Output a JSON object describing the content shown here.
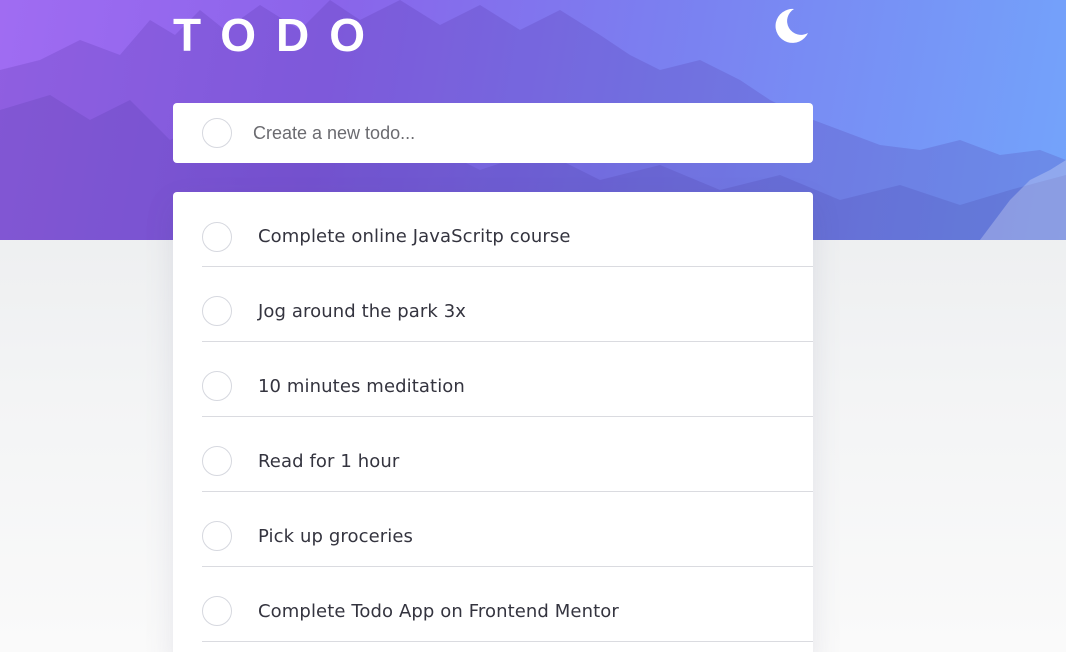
{
  "header": {
    "title": "TODO",
    "theme_icon": "moon-icon"
  },
  "new_todo": {
    "placeholder": "Create a new todo...",
    "value": ""
  },
  "todos": [
    {
      "label": "Complete online JavaScritp course",
      "completed": false
    },
    {
      "label": "Jog around the park 3x",
      "completed": false
    },
    {
      "label": "10 minutes meditation",
      "completed": false
    },
    {
      "label": "Read for 1 hour",
      "completed": false
    },
    {
      "label": "Pick up groceries",
      "completed": false
    },
    {
      "label": "Complete Todo App on Frontend Mentor",
      "completed": false
    }
  ],
  "colors": {
    "gradient_start": "#a06cf2",
    "gradient_end": "#73a4fb",
    "card_bg": "#ffffff",
    "text": "#34343f",
    "divider": "#dadbe0"
  }
}
